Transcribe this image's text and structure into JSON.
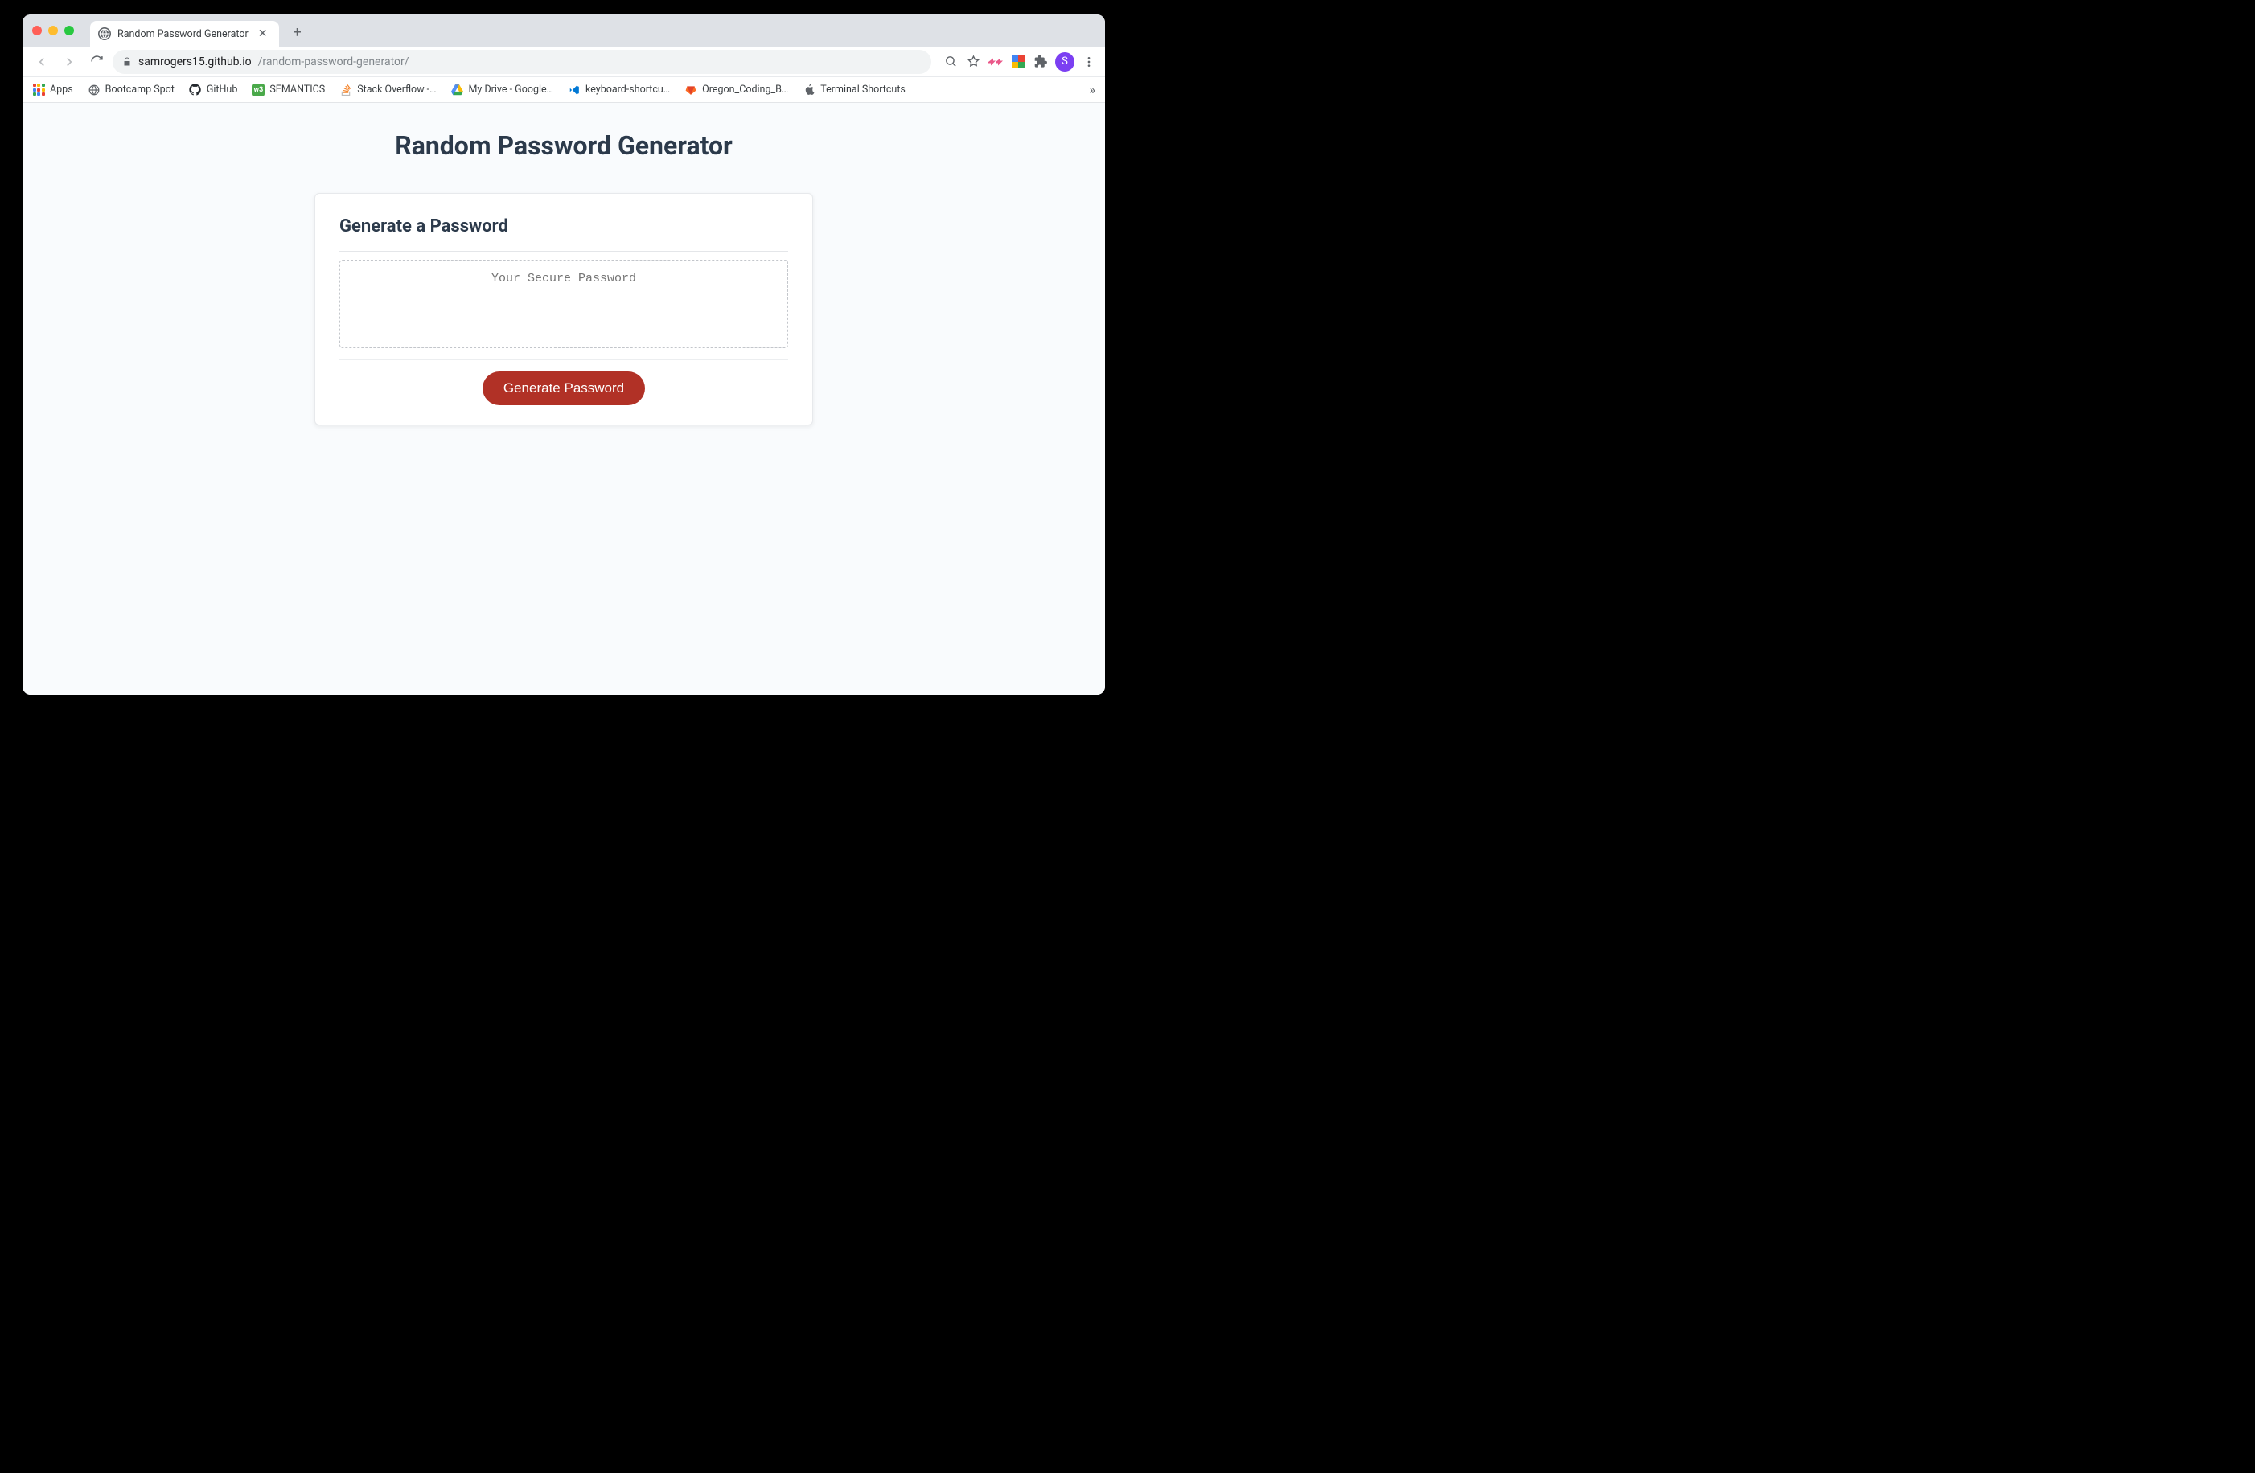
{
  "browser": {
    "tab": {
      "title": "Random Password Generator"
    },
    "url": {
      "host": "samrogers15.github.io",
      "path": "/random-password-generator/"
    },
    "avatar_letter": "S"
  },
  "bookmarks": [
    {
      "label": "Apps"
    },
    {
      "label": "Bootcamp Spot"
    },
    {
      "label": "GitHub"
    },
    {
      "label": "SEMANTICS"
    },
    {
      "label": "Stack Overflow -…"
    },
    {
      "label": "My Drive - Google…"
    },
    {
      "label": "keyboard-shortcu…"
    },
    {
      "label": "Oregon_Coding_B…"
    },
    {
      "label": "Terminal Shortcuts"
    }
  ],
  "page": {
    "title": "Random Password Generator",
    "card_heading": "Generate a Password",
    "placeholder": "Your Secure Password",
    "button_label": "Generate Password"
  }
}
